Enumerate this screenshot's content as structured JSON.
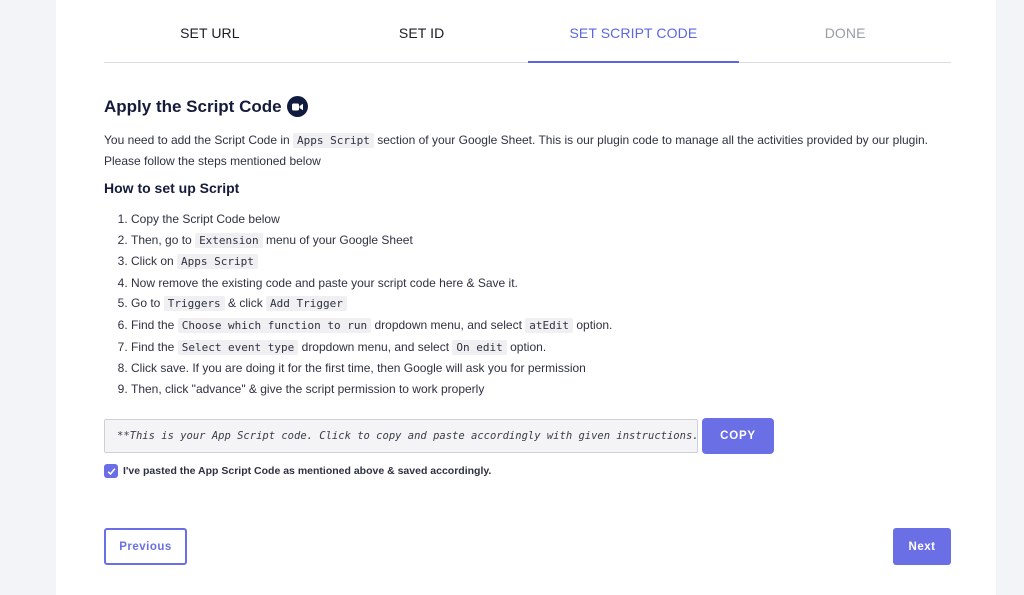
{
  "tabs": [
    {
      "label": "SET URL",
      "state": "default"
    },
    {
      "label": "SET ID",
      "state": "default"
    },
    {
      "label": "SET SCRIPT CODE",
      "state": "active"
    },
    {
      "label": "DONE",
      "state": "disabled"
    }
  ],
  "section": {
    "title": "Apply the Script Code",
    "title_icon": "video-camera-icon",
    "intro_before": "You need to add the Script Code in",
    "intro_code": "Apps Script",
    "intro_after": "section of your Google Sheet. This is our plugin code to manage all the activities provided by our plugin. Please follow the steps mentioned below"
  },
  "howto": {
    "heading": "How to set up Script",
    "steps": [
      {
        "parts": [
          {
            "t": "Copy the Script Code below"
          }
        ]
      },
      {
        "parts": [
          {
            "t": "Then, go to"
          },
          {
            "c": "Extension"
          },
          {
            "t": "menu of your Google Sheet"
          }
        ]
      },
      {
        "parts": [
          {
            "t": "Click on"
          },
          {
            "c": "Apps Script"
          }
        ]
      },
      {
        "parts": [
          {
            "t": "Now remove the existing code and paste your script code here & Save it."
          }
        ]
      },
      {
        "parts": [
          {
            "t": "Go to"
          },
          {
            "c": "Triggers"
          },
          {
            "t": "& click"
          },
          {
            "c": "Add Trigger"
          }
        ]
      },
      {
        "parts": [
          {
            "t": "Find the"
          },
          {
            "c": "Choose which function to run"
          },
          {
            "t": "dropdown menu, and select"
          },
          {
            "c": "atEdit"
          },
          {
            "t": "option."
          }
        ]
      },
      {
        "parts": [
          {
            "t": "Find the"
          },
          {
            "c": "Select event type"
          },
          {
            "t": "dropdown menu, and select"
          },
          {
            "c": "On edit"
          },
          {
            "t": "option."
          }
        ]
      },
      {
        "parts": [
          {
            "t": "Click save. If you are doing it for the first time, then Google will ask you for permission"
          }
        ]
      },
      {
        "parts": [
          {
            "t": "Then, click \"advance\" & give the script permission to work properly"
          }
        ]
      }
    ]
  },
  "code_box": {
    "text": "**This is your App Script code. Click to copy and paste accordingly with given instructions.**",
    "copy_label": "COPY"
  },
  "confirm": {
    "checked": true,
    "label": "I've pasted the App Script Code as mentioned above & saved accordingly."
  },
  "nav": {
    "previous_label": "Previous",
    "next_label": "Next"
  },
  "colors": {
    "accent": "#6b6fe6",
    "active_tab": "#5b67e0",
    "heading": "#151b3a"
  }
}
